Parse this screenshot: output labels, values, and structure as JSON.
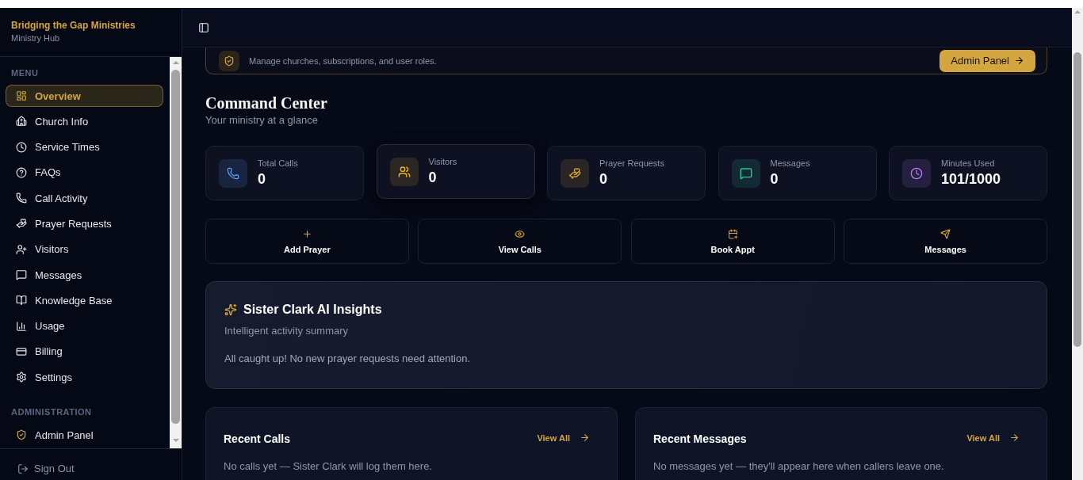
{
  "sidebar": {
    "brand": {
      "name": "Bridging the Gap Ministries",
      "subtitle": "Ministry Hub"
    },
    "sections": [
      {
        "heading": "MENU",
        "items": [
          {
            "label": "Overview",
            "selected": true
          },
          {
            "label": "Church Info",
            "selected": false
          },
          {
            "label": "Service Times",
            "selected": false
          },
          {
            "label": "FAQs",
            "selected": false
          },
          {
            "label": "Call Activity",
            "selected": false
          },
          {
            "label": "Prayer Requests",
            "selected": false
          },
          {
            "label": "Visitors",
            "selected": false
          },
          {
            "label": "Messages",
            "selected": false
          },
          {
            "label": "Knowledge Base",
            "selected": false
          },
          {
            "label": "Usage",
            "selected": false
          },
          {
            "label": "Billing",
            "selected": false
          },
          {
            "label": "Settings",
            "selected": false
          }
        ]
      },
      {
        "heading": "ADMINISTRATION",
        "items": [
          {
            "label": "Admin Panel",
            "selected": false
          }
        ]
      }
    ],
    "sign_out": "Sign Out"
  },
  "banner": {
    "subtitle": "Manage churches, subscriptions, and user roles.",
    "button": "Admin Panel"
  },
  "page": {
    "title": "Command Center",
    "subtitle": "Your ministry at a glance"
  },
  "stats": [
    {
      "label": "Total Calls",
      "value": "0",
      "color": "#5b9cf5",
      "hovered": false
    },
    {
      "label": "Visitors",
      "value": "0",
      "color": "#f0b429",
      "hovered": true
    },
    {
      "label": "Prayer Requests",
      "value": "0",
      "color": "#d4a640",
      "hovered": false
    },
    {
      "label": "Messages",
      "value": "0",
      "color": "#2fc79a",
      "hovered": false
    },
    {
      "label": "Minutes Used",
      "value": "101/1000",
      "color": "#b57cf0",
      "hovered": false
    }
  ],
  "actions": [
    {
      "label": "Add Prayer"
    },
    {
      "label": "View Calls"
    },
    {
      "label": "Book Appt"
    },
    {
      "label": "Messages"
    }
  ],
  "insights": {
    "title": "Sister Clark AI Insights",
    "subtitle": "Intelligent activity summary",
    "body": "All caught up! No new prayer requests need attention."
  },
  "recent": [
    {
      "title": "Recent Calls",
      "link": "View All",
      "empty": "No calls yet — Sister Clark will log them here."
    },
    {
      "title": "Recent Messages",
      "link": "View All",
      "empty": "No messages yet — they'll appear here when callers leave one."
    }
  ]
}
